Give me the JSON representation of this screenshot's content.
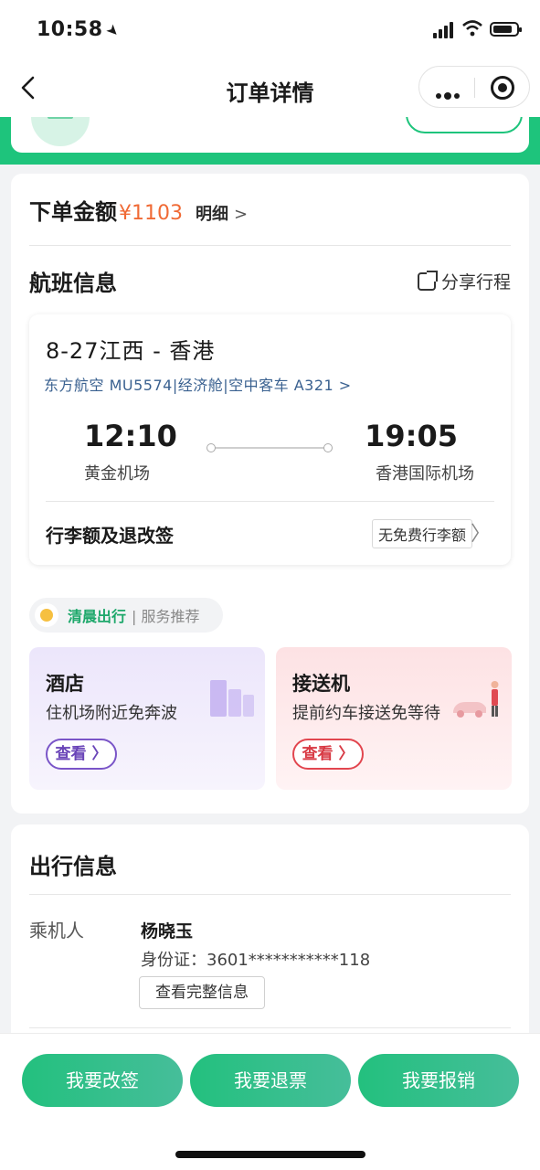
{
  "status_bar": {
    "time": "10:58",
    "location_icon": "location-arrow-icon"
  },
  "nav": {
    "title": "订单详情",
    "back_icon": "chevron-left-icon",
    "more_icon": "more-dots-icon",
    "close_icon": "target-circle-icon"
  },
  "order": {
    "amount_label": "下单金额",
    "amount_value": "¥1103",
    "detail_label": "明细",
    "detail_chevron": ">"
  },
  "flight": {
    "section_title": "航班信息",
    "share_label": "分享行程",
    "route": "8-27江西 - 香港",
    "meta": "东方航空 MU5574|经济舱|空中客车 A321 >",
    "dep_time": "12:10",
    "dep_airport": "黄金机场",
    "arr_time": "19:05",
    "arr_airport": "香港国际机场",
    "baggage_label": "行李额及退改签",
    "baggage_tag": "无免费行李额",
    "baggage_chevron": "〉"
  },
  "recommend": {
    "tag_main": "清晨出行",
    "tag_sub": "| 服务推荐"
  },
  "services": [
    {
      "title": "酒店",
      "subtitle": "住机场附近免奔波",
      "button": "查看 〉"
    },
    {
      "title": "接送机",
      "subtitle": "提前约车接送免等待",
      "button": "查看 〉"
    }
  ],
  "travel_info": {
    "title": "出行信息",
    "passenger_label": "乘机人",
    "passenger_name": "杨晓玉",
    "passenger_id": "身份证：3601***********118",
    "full_info_button": "查看完整信息"
  },
  "actions": {
    "change": "我要改签",
    "refund": "我要退票",
    "reimburse": "我要报销"
  },
  "colors": {
    "brand_green": "#1ec47c",
    "price_orange": "#f06a35",
    "hotel_purple": "#6a45b8",
    "transfer_red": "#d83a44"
  }
}
